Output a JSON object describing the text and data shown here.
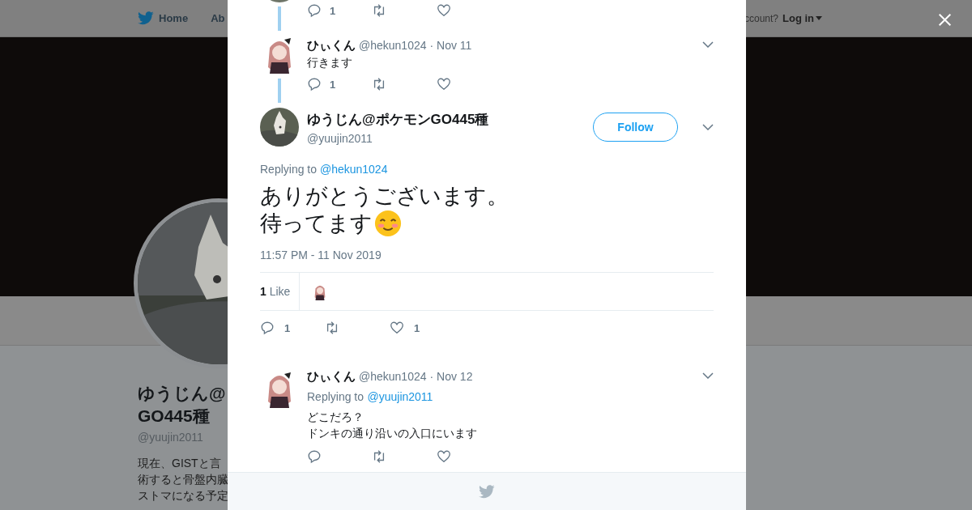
{
  "background_page": {
    "nav": {
      "items": [
        {
          "label": "Home",
          "kind": "home"
        },
        {
          "label": "Ab",
          "kind": "plain"
        }
      ],
      "account_prompt": "ccount?",
      "login": "Log in"
    },
    "profile": {
      "name_lines": [
        "ゆうじん@",
        "GO445種"
      ],
      "handle": "@yuujin2011",
      "bio_lines": [
        "現在、GISTと言",
        "術すると骨盤内臓",
        "ストマになる予定"
      ]
    }
  },
  "modal": {
    "previous_actions": {
      "replies": "1"
    },
    "thread_reply": {
      "name": "ひぃくん",
      "handle": "@hekun1024",
      "date": "· Nov 11",
      "text": "行きます",
      "actions": {
        "replies": "1"
      }
    },
    "main_tweet": {
      "name": "ゆうじん@ポケモンGO445種",
      "handle": "@yuujin2011",
      "follow": "Follow",
      "replying_label": "Replying to",
      "replying_to": "@hekun1024",
      "text_lines": [
        "ありがとうございます。",
        "待ってます"
      ],
      "timestamp": "11:57 PM - 11 Nov 2019",
      "likes_label": "**1** Like",
      "actions": {
        "replies": "1",
        "likes": "1"
      }
    },
    "replies": [
      {
        "name": "ひぃくん",
        "handle": "@hekun1024",
        "date": "· Nov 12",
        "replying_label": "Replying to",
        "replying_to": "@yuujin2011",
        "text_lines": [
          "どこだろ？",
          "ドンキの通り沿いの入口にいます"
        ]
      }
    ]
  }
}
